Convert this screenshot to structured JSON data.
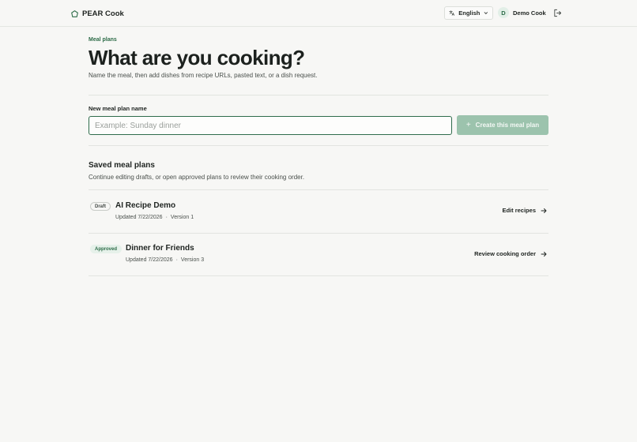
{
  "header": {
    "brand": "PEAR Cook",
    "brand_icon": "home-shield-icon",
    "language": "English",
    "user_initial": "D",
    "user_name": "Demo Cook"
  },
  "hero": {
    "eyebrow": "Meal plans",
    "title": "What are you cooking?",
    "subtitle": "Name the meal, then add dishes from recipe URLs, pasted text, or a dish request."
  },
  "create_form": {
    "label": "New meal plan name",
    "placeholder": "Example: Sunday dinner",
    "value": "",
    "button_label": "Create this meal plan"
  },
  "saved": {
    "title": "Saved meal plans",
    "subtitle": "Continue editing drafts, or open approved plans to review their cooking order.",
    "plans": [
      {
        "status": "Draft",
        "name": "AI Recipe Demo",
        "updated": "Updated 7/22/2026",
        "separator": "·",
        "version": "Version 1",
        "action": "Edit recipes"
      },
      {
        "status": "Approved",
        "name": "Dinner for Friends",
        "updated": "Updated 7/22/2026",
        "separator": "·",
        "version": "Version 3",
        "action": "Review cooking order"
      }
    ]
  },
  "colors": {
    "accent": "#2c6b47",
    "button_disabled": "#9cc3ad",
    "background": "#f7f7f5"
  }
}
